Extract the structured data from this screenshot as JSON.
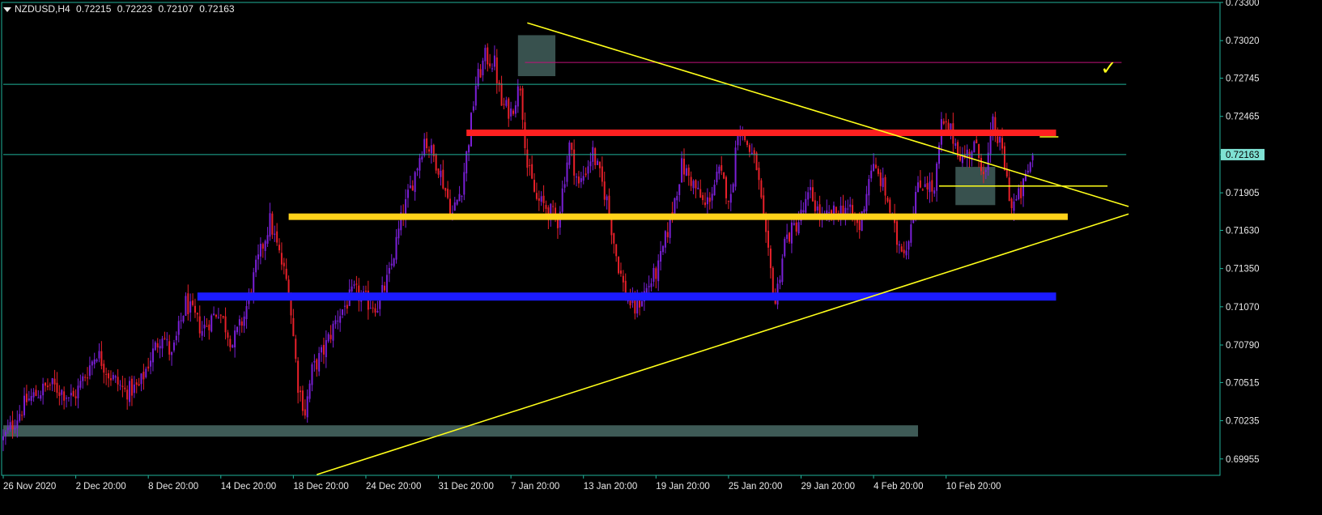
{
  "header": {
    "symbol": "NZDUSD,H4",
    "open": "0.72215",
    "high": "0.72223",
    "low": "0.72107",
    "close": "0.72163"
  },
  "colors": {
    "background": "#000000",
    "grid": "#1fb29a",
    "bull": "#7a1fd6",
    "bear": "#e8202a",
    "support_yellow": "#ffd21a",
    "support_blue": "#1b1bff",
    "resistance_red": "#ff2020",
    "trendline": "#ffff1a",
    "zone": "#3e5a56",
    "bid_label_bg": "#7fe1d3",
    "magenta_line": "#c0127a"
  },
  "chart_data": {
    "type": "candlestick",
    "title": "NZDUSD,H4",
    "ylim": [
      0.69835,
      0.733
    ],
    "ytick_labels": [
      "0.73300",
      "0.73020",
      "0.72745",
      "0.72465",
      "0.72163",
      "0.71905",
      "0.71630",
      "0.71350",
      "0.71070",
      "0.70790",
      "0.70515",
      "0.70235",
      "0.69955"
    ],
    "ytick_values": [
      0.733,
      0.7302,
      0.72745,
      0.72465,
      0.72185,
      0.71905,
      0.7163,
      0.7135,
      0.7107,
      0.7079,
      0.70515,
      0.70235,
      0.69955
    ],
    "xtick_labels": [
      "26 Nov 2020",
      "2 Dec 20:00",
      "8 Dec 20:00",
      "14 Dec 20:00",
      "18 Dec 20:00",
      "24 Dec 20:00",
      "31 Dec 20:00",
      "7 Jan 20:00",
      "13 Jan 20:00",
      "19 Jan 20:00",
      "25 Jan 20:00",
      "29 Jan 20:00",
      "4 Feb 20:00",
      "10 Feb 20:00"
    ],
    "xtick_index": [
      0,
      31,
      62,
      93,
      124,
      155,
      186,
      217,
      248,
      279,
      310,
      341,
      372,
      403
    ],
    "candle_count": 415,
    "price_path": [
      [
        0,
        0.701
      ],
      [
        10,
        0.7038
      ],
      [
        20,
        0.705
      ],
      [
        30,
        0.704
      ],
      [
        40,
        0.7074
      ],
      [
        45,
        0.7058
      ],
      [
        52,
        0.7045
      ],
      [
        58,
        0.7048
      ],
      [
        63,
        0.707
      ],
      [
        68,
        0.7088
      ],
      [
        72,
        0.707
      ],
      [
        78,
        0.711
      ],
      [
        85,
        0.709
      ],
      [
        92,
        0.7105
      ],
      [
        98,
        0.708
      ],
      [
        103,
        0.71
      ],
      [
        108,
        0.7135
      ],
      [
        114,
        0.717
      ],
      [
        118,
        0.7145
      ],
      [
        122,
        0.712
      ],
      [
        126,
        0.705
      ],
      [
        129,
        0.703
      ],
      [
        132,
        0.706
      ],
      [
        137,
        0.7075
      ],
      [
        143,
        0.71
      ],
      [
        150,
        0.7118
      ],
      [
        156,
        0.711
      ],
      [
        160,
        0.7108
      ],
      [
        165,
        0.713
      ],
      [
        170,
        0.717
      ],
      [
        176,
        0.7205
      ],
      [
        180,
        0.723
      ],
      [
        186,
        0.721
      ],
      [
        192,
        0.7175
      ],
      [
        196,
        0.7195
      ],
      [
        199,
        0.723
      ],
      [
        202,
        0.727
      ],
      [
        206,
        0.729
      ],
      [
        210,
        0.7285
      ],
      [
        213,
        0.7255
      ],
      [
        217,
        0.725
      ],
      [
        221,
        0.727
      ],
      [
        224,
        0.721
      ],
      [
        228,
        0.7185
      ],
      [
        232,
        0.718
      ],
      [
        237,
        0.717
      ],
      [
        242,
        0.7225
      ],
      [
        246,
        0.7195
      ],
      [
        252,
        0.722
      ],
      [
        258,
        0.7185
      ],
      [
        262,
        0.7145
      ],
      [
        266,
        0.7115
      ],
      [
        270,
        0.7105
      ],
      [
        275,
        0.712
      ],
      [
        280,
        0.7135
      ],
      [
        285,
        0.717
      ],
      [
        290,
        0.721
      ],
      [
        294,
        0.72
      ],
      [
        300,
        0.718
      ],
      [
        306,
        0.7205
      ],
      [
        311,
        0.7185
      ],
      [
        314,
        0.724
      ],
      [
        317,
        0.723
      ],
      [
        322,
        0.721
      ],
      [
        326,
        0.7155
      ],
      [
        330,
        0.711
      ],
      [
        334,
        0.7155
      ],
      [
        340,
        0.717
      ],
      [
        345,
        0.719
      ],
      [
        350,
        0.717
      ],
      [
        355,
        0.7175
      ],
      [
        360,
        0.718
      ],
      [
        366,
        0.7165
      ],
      [
        371,
        0.721
      ],
      [
        375,
        0.72
      ],
      [
        378,
        0.7185
      ],
      [
        382,
        0.7155
      ],
      [
        386,
        0.715
      ],
      [
        390,
        0.719
      ],
      [
        394,
        0.72
      ],
      [
        398,
        0.719
      ],
      [
        401,
        0.724
      ],
      [
        405,
        0.7235
      ],
      [
        410,
        0.7215
      ],
      [
        415,
        0.7225
      ],
      [
        420,
        0.7205
      ],
      [
        423,
        0.724
      ],
      [
        427,
        0.722
      ],
      [
        431,
        0.718
      ],
      [
        435,
        0.719
      ],
      [
        440,
        0.7218
      ]
    ],
    "price_lines": [
      {
        "name": "red-resistance",
        "y": 0.72345,
        "x_from": 198,
        "x_to": 450
      },
      {
        "name": "yellow-support",
        "y": 0.7173,
        "x_from": 122,
        "x_to": 455
      },
      {
        "name": "blue-support",
        "y": 0.71145,
        "x_from": 83,
        "x_to": 450
      },
      {
        "name": "gray-zone",
        "y": 0.7016,
        "x_from": 0,
        "x_to": 391
      },
      {
        "name": "cyan-level-upper",
        "y": 0.727,
        "x_from": 0,
        "x_to": 480
      },
      {
        "name": "cyan-level-bid",
        "y": 0.72185,
        "x_from": 0,
        "x_to": 480
      },
      {
        "name": "thin-yellow-right",
        "y": 0.72315,
        "x_from": 443,
        "x_to": 451
      },
      {
        "name": "thin-yellow-mid",
        "y": 0.71955,
        "x_from": 400,
        "x_to": 472
      },
      {
        "name": "magenta-target",
        "y": 0.7286,
        "x_from": 223,
        "x_to": 478
      }
    ],
    "trendlines": [
      {
        "name": "descending",
        "x1": 224,
        "y1": 0.7315,
        "x2": 481,
        "y2": 0.71805
      },
      {
        "name": "ascending",
        "x1": 134,
        "y1": 0.6984,
        "x2": 481,
        "y2": 0.7175
      }
    ],
    "zones": [
      {
        "name": "top-zone",
        "x1": 220,
        "x2": 236,
        "y1": 0.7276,
        "y2": 0.7306
      },
      {
        "name": "right-zone",
        "x1": 407,
        "x2": 424,
        "y1": 0.71815,
        "y2": 0.72095
      }
    ],
    "annotations": [
      {
        "name": "checkmark",
        "text": "✓",
        "at_x": 469,
        "at_y": 0.7282
      }
    ],
    "bid": "0.72163",
    "grid": false,
    "legend": "none"
  }
}
